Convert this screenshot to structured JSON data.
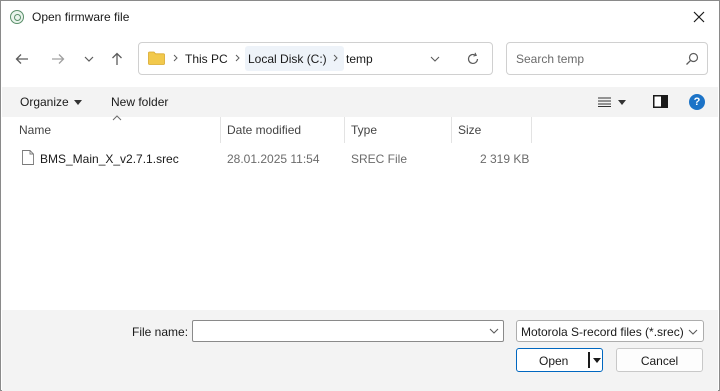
{
  "window": {
    "title": "Open firmware file"
  },
  "nav": {
    "breadcrumbs": [
      "This PC",
      "Local Disk (C:)",
      "temp"
    ]
  },
  "search": {
    "placeholder": "Search temp"
  },
  "toolbar": {
    "organize_label": "Organize",
    "new_folder_label": "New folder",
    "help_label": "?"
  },
  "filelist": {
    "columns": [
      "Name",
      "Date modified",
      "Type",
      "Size"
    ],
    "rows": [
      {
        "name": "BMS_Main_X_v2.7.1.srec",
        "date": "28.01.2025 11:54",
        "type": "SREC File",
        "size": "2 319 KB"
      }
    ]
  },
  "bottom": {
    "file_name_label": "File name:",
    "file_name_value": "",
    "filter_selected": "Motorola S-record files (*.srec)",
    "open_label": "Open",
    "cancel_label": "Cancel"
  },
  "icons": {
    "app": "app-icon",
    "close": "close-icon",
    "back": "back-arrow-icon",
    "forward": "forward-arrow-icon",
    "recent": "chevron-down-icon",
    "up": "up-arrow-icon",
    "folder": "folder-icon",
    "refresh": "refresh-icon",
    "search": "search-icon",
    "file": "file-icon",
    "help": "help-icon"
  },
  "colors": {
    "accent": "#0067c0",
    "help_bg": "#1c73c7",
    "folder": "#f2c94c",
    "toolbar_bg": "#f3f3f3"
  }
}
